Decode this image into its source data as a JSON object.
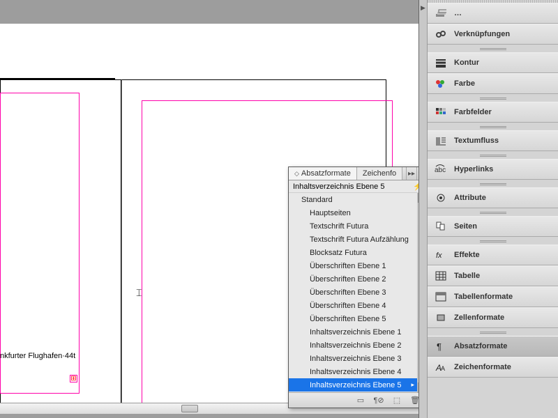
{
  "canvas": {
    "visible_text": "nkfurter Flughafen·44t",
    "overset_marker": "⊞",
    "cursor_glyph": "⌶"
  },
  "popup": {
    "tabs": [
      {
        "label": "Absatzformate",
        "active": true,
        "sort_glyph": "◇"
      },
      {
        "label": "Zeichenfo",
        "active": false,
        "sort_glyph": ""
      }
    ],
    "expand_glyph": "▸▸",
    "menu_glyph": "▾≡",
    "current_style": "Inhaltsverzeichnis Ebene 5",
    "thunder_glyph": "⚡",
    "items": [
      {
        "label": "Standard",
        "shallow": true,
        "selected": false
      },
      {
        "label": "Hauptseiten",
        "shallow": false,
        "selected": false
      },
      {
        "label": "Textschrift Futura",
        "shallow": false,
        "selected": false
      },
      {
        "label": "Textschrift Futura Aufzählung",
        "shallow": false,
        "selected": false
      },
      {
        "label": "Blocksatz Futura",
        "shallow": false,
        "selected": false
      },
      {
        "label": "Überschriften Ebene 1",
        "shallow": false,
        "selected": false
      },
      {
        "label": "Überschriften Ebene 2",
        "shallow": false,
        "selected": false
      },
      {
        "label": "Überschriften Ebene 3",
        "shallow": false,
        "selected": false
      },
      {
        "label": "Überschriften Ebene 4",
        "shallow": false,
        "selected": false
      },
      {
        "label": "Überschriften Ebene 5",
        "shallow": false,
        "selected": false
      },
      {
        "label": "Inhaltsverzeichnis Ebene 1",
        "shallow": false,
        "selected": false
      },
      {
        "label": "Inhaltsverzeichnis Ebene 2",
        "shallow": false,
        "selected": false
      },
      {
        "label": "Inhaltsverzeichnis Ebene 3",
        "shallow": false,
        "selected": false
      },
      {
        "label": "Inhaltsverzeichnis Ebene 4",
        "shallow": false,
        "selected": false
      },
      {
        "label": "Inhaltsverzeichnis Ebene 5",
        "shallow": false,
        "selected": true
      }
    ],
    "footer_icons": {
      "folder": "▭",
      "clear": "¶⊘",
      "new": "⬚",
      "trash": "🗑"
    }
  },
  "dock": {
    "groups": [
      {
        "items": [
          {
            "icon": "layers-icon",
            "label": "…"
          },
          {
            "icon": "links-icon",
            "label": "Verknüpfungen"
          }
        ]
      },
      {
        "items": [
          {
            "icon": "stroke-icon",
            "label": "Kontur"
          },
          {
            "icon": "color-icon",
            "label": "Farbe"
          }
        ]
      },
      {
        "items": [
          {
            "icon": "swatches-icon",
            "label": "Farbfelder"
          }
        ]
      },
      {
        "items": [
          {
            "icon": "textwrap-icon",
            "label": "Textumfluss"
          }
        ]
      },
      {
        "items": [
          {
            "icon": "hyperlink-icon",
            "label": "Hyperlinks"
          }
        ]
      },
      {
        "items": [
          {
            "icon": "attributes-icon",
            "label": "Attribute"
          }
        ]
      },
      {
        "items": [
          {
            "icon": "pages-icon",
            "label": "Seiten"
          }
        ]
      },
      {
        "items": [
          {
            "icon": "effects-icon",
            "label": "Effekte"
          },
          {
            "icon": "table-icon",
            "label": "Tabelle"
          },
          {
            "icon": "tablestyles-icon",
            "label": "Tabellenformate"
          },
          {
            "icon": "cellstyles-icon",
            "label": "Zellenformate"
          }
        ]
      },
      {
        "items": [
          {
            "icon": "parastyles-icon",
            "label": "Absatzformate",
            "active": true
          },
          {
            "icon": "charstyles-icon",
            "label": "Zeichenformate"
          }
        ]
      }
    ]
  }
}
